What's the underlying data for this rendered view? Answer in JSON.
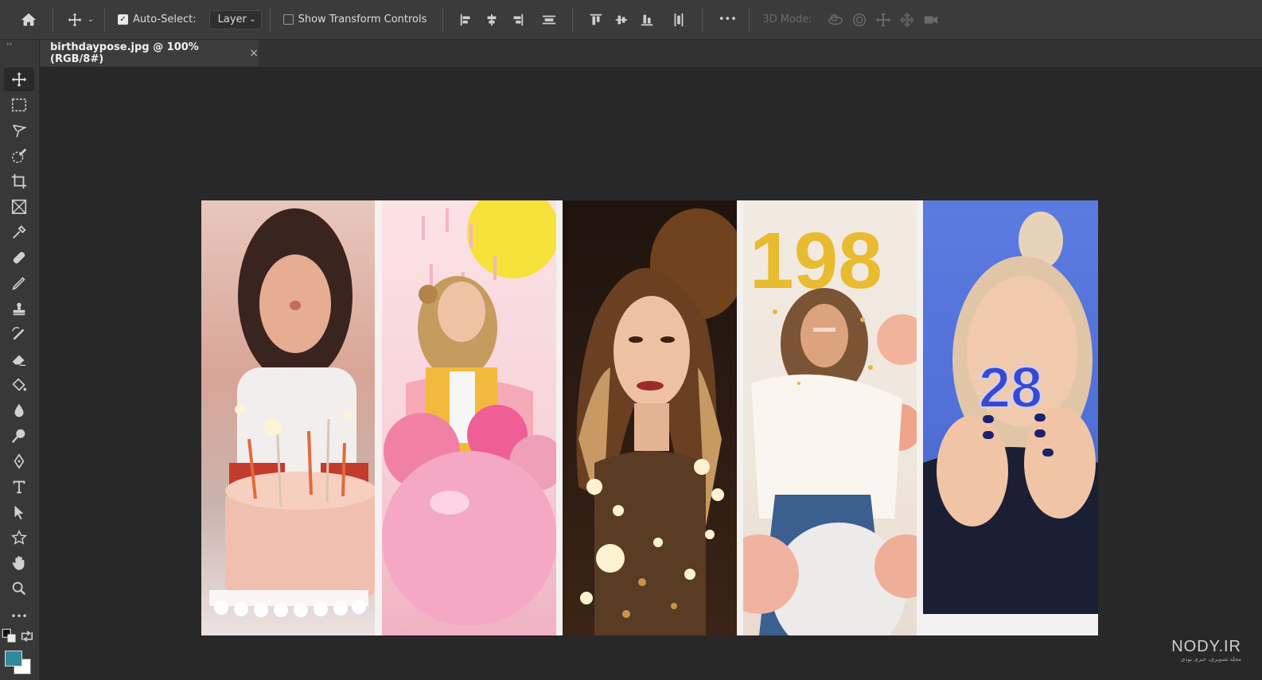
{
  "options_bar": {
    "auto_select_label": "Auto-Select:",
    "auto_select_checked": true,
    "layer_select_value": "Layer",
    "show_transform_label": "Show Transform Controls",
    "show_transform_checked": false,
    "more_label": "•••",
    "mode_3d_label": "3D Mode:"
  },
  "document_tab": {
    "title": "birthdaypose.jpg @ 100% (RGB/8#)",
    "close_glyph": "×"
  },
  "toolbar": {
    "collapse_glyph": "››",
    "more_glyph": "•••"
  },
  "colors": {
    "foreground": "#2f8a9a",
    "background": "#ffffff",
    "accent": "#3b3b3b"
  },
  "watermark": {
    "brand": "NODY.IR",
    "tagline": "مجله تصویری، خبری نودی"
  },
  "image": {
    "panels": [
      "birthday-cake-woman",
      "balloon-woman",
      "sparkler-portrait",
      "1989-balloons-woman",
      "candle-28-hands"
    ],
    "balloon_digits_1": "198",
    "candle_digits": "28"
  }
}
